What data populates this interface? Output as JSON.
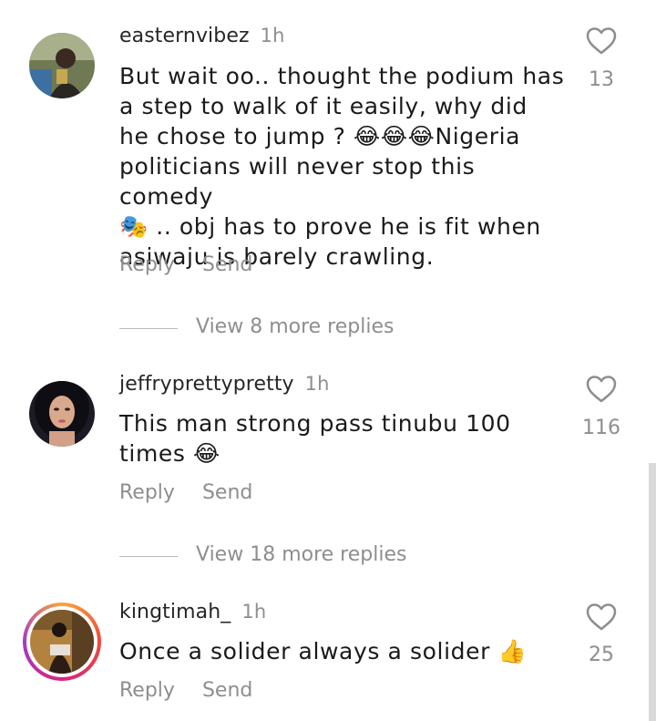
{
  "comments": [
    {
      "username": "easternvibez",
      "time": "1h",
      "text": "But wait oo.. thought the podium has\na step to walk of it easily, why did\nhe chose to jump ? 😂😂😂Nigeria\npoliticians will never stop this comedy\n🎭 .. obj has to prove he is fit when\nasiwaju is barely crawling.",
      "likes": "13",
      "reply_label": "Reply",
      "send_label": "Send",
      "view_replies": "View 8 more replies"
    },
    {
      "username": "jeffryprettypretty",
      "time": "1h",
      "text": "This man strong pass tinubu 100\ntimes 😂",
      "likes": "116",
      "reply_label": "Reply",
      "send_label": "Send",
      "view_replies": "View 18 more replies"
    },
    {
      "username": "kingtimah_",
      "time": "1h",
      "text": "Once a solider always a solider 👍",
      "likes": "25",
      "reply_label": "Reply",
      "send_label": "Send",
      "has_story_ring": true
    }
  ],
  "icons": {
    "like": "heart-outline-icon"
  },
  "colors": {
    "secondary_text": "#8e8e8e",
    "primary_text": "#262626"
  }
}
